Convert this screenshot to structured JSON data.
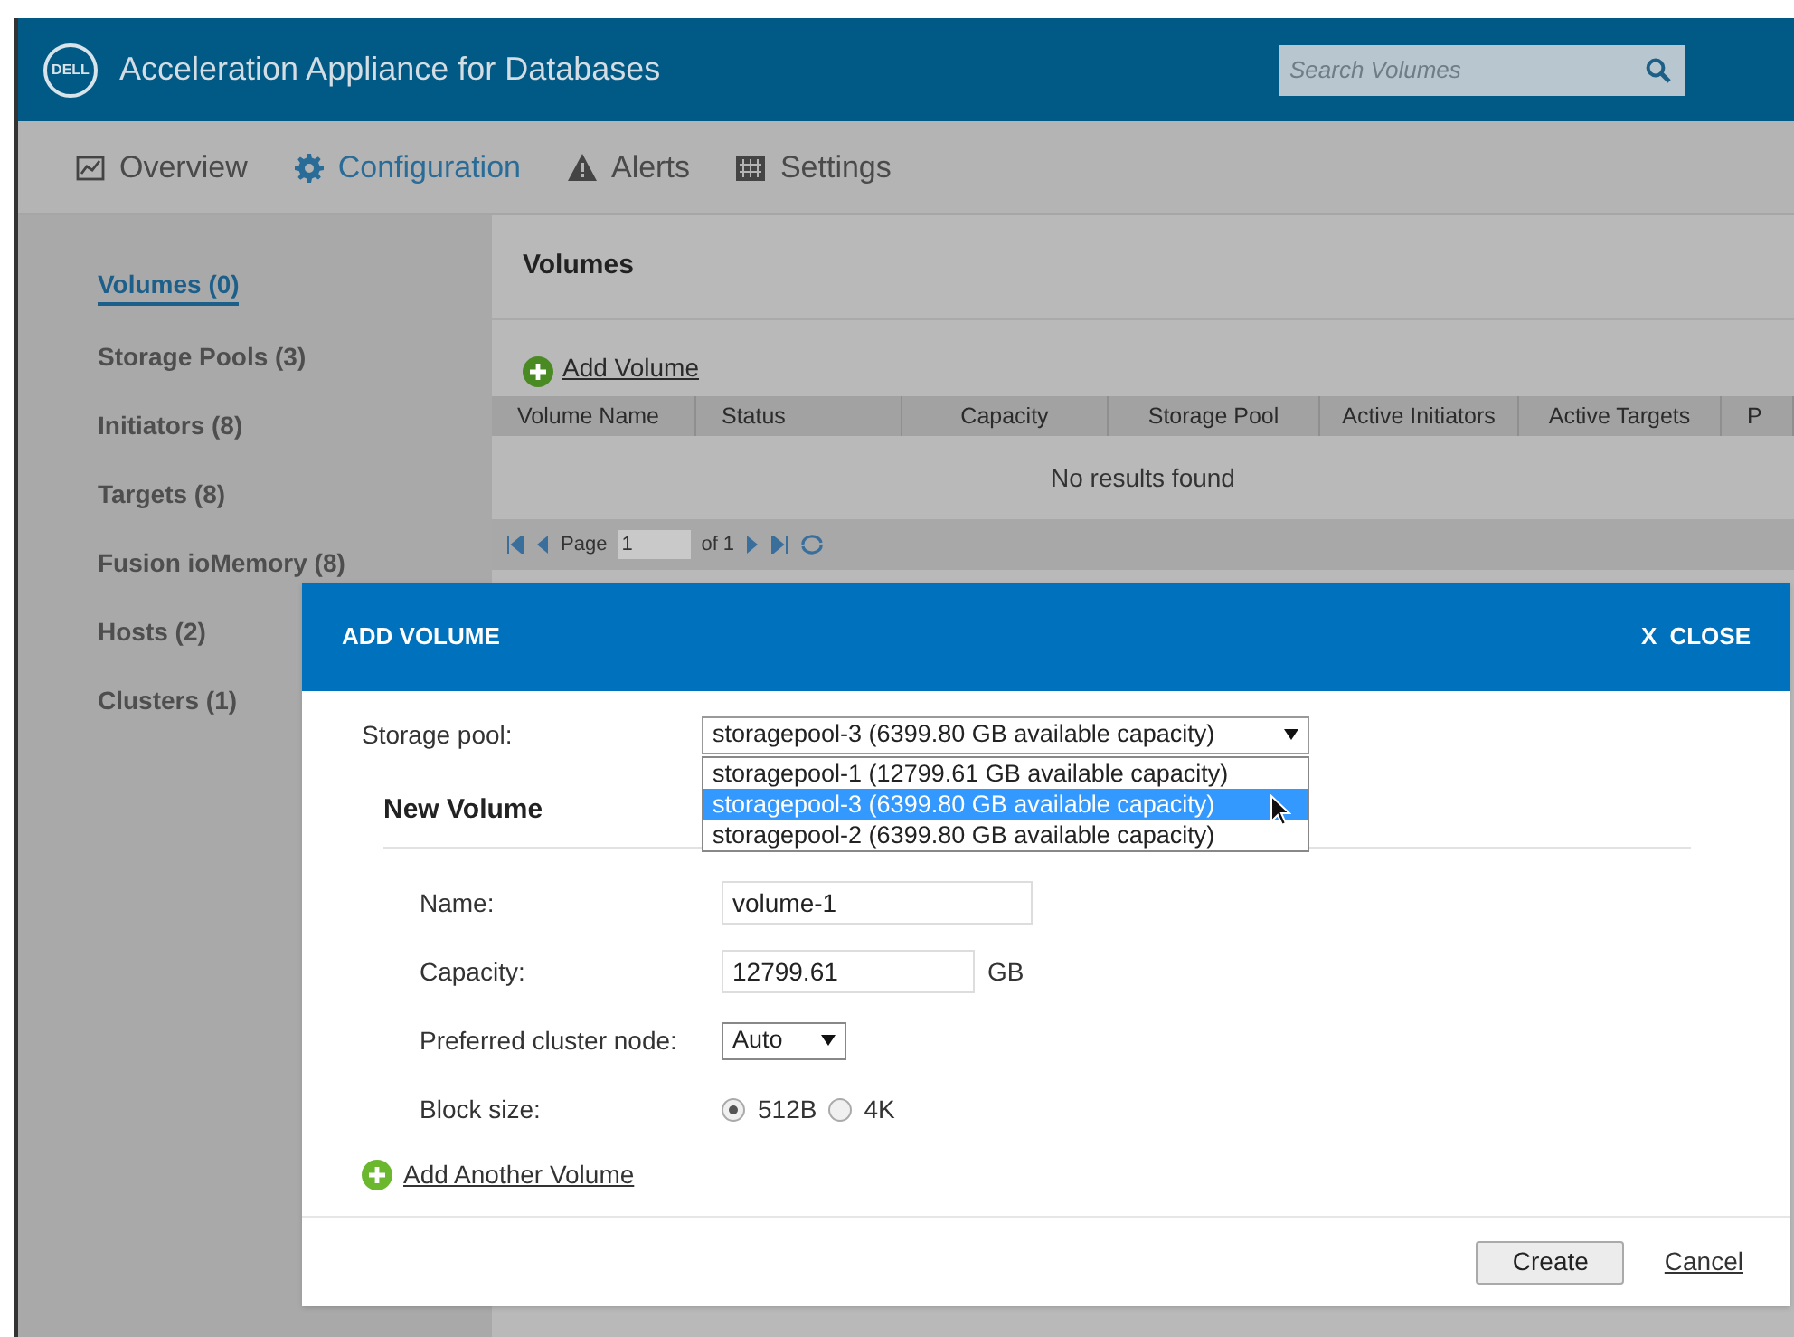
{
  "header": {
    "logo": "DELL",
    "title": "Acceleration Appliance for Databases",
    "search": {
      "placeholder": "Search Volumes"
    }
  },
  "nav": [
    {
      "label": "Overview",
      "kind": "chart",
      "selected": false
    },
    {
      "label": "Configuration",
      "kind": "gear",
      "selected": true
    },
    {
      "label": "Alerts",
      "kind": "warning",
      "selected": false
    },
    {
      "label": "Settings",
      "kind": "grid",
      "selected": false
    }
  ],
  "sidebar": {
    "items": [
      {
        "label": "Volumes (0)",
        "selected": true
      },
      {
        "label": "Storage Pools (3)",
        "selected": false
      },
      {
        "label": "Initiators (8)",
        "selected": false
      },
      {
        "label": "Targets (8)",
        "selected": false
      },
      {
        "label": "Fusion ioMemory (8)",
        "selected": false
      },
      {
        "label": "Hosts (2)",
        "selected": false
      },
      {
        "label": "Clusters (1)",
        "selected": false
      }
    ]
  },
  "main": {
    "title": "Volumes",
    "add_link": "Add Volume",
    "table": {
      "columns": [
        "Volume Name",
        "Status",
        "Capacity",
        "Storage Pool",
        "Active Initiators",
        "Active Targets",
        "P"
      ],
      "empty": "No results found"
    },
    "pagination": {
      "page_label": "Page",
      "page": "1",
      "of": "of 1"
    }
  },
  "dialog": {
    "title": "ADD VOLUME",
    "close_icon": "X",
    "close": "CLOSE",
    "storage_pool": {
      "label": "Storage pool:",
      "value": "storagepool-3 (6399.80 GB available capacity)",
      "options": [
        {
          "label": "storagepool-1 (12799.61 GB available capacity)",
          "selected": false
        },
        {
          "label": "storagepool-3 (6399.80 GB available capacity)",
          "selected": true
        },
        {
          "label": "storagepool-2 (6399.80 GB available capacity)",
          "selected": false
        }
      ]
    },
    "section": "New Volume",
    "name": {
      "label": "Name:",
      "value": "volume-1"
    },
    "capacity": {
      "label": "Capacity:",
      "value": "12799.61",
      "unit": "GB"
    },
    "node": {
      "label": "Preferred cluster node:",
      "value": "Auto"
    },
    "block_size": {
      "label": "Block size:",
      "options": [
        {
          "label": "512B",
          "selected": true
        },
        {
          "label": "4K",
          "selected": false
        }
      ]
    },
    "add_another": "Add Another Volume",
    "buttons": {
      "create": "Create",
      "cancel": "Cancel"
    }
  }
}
